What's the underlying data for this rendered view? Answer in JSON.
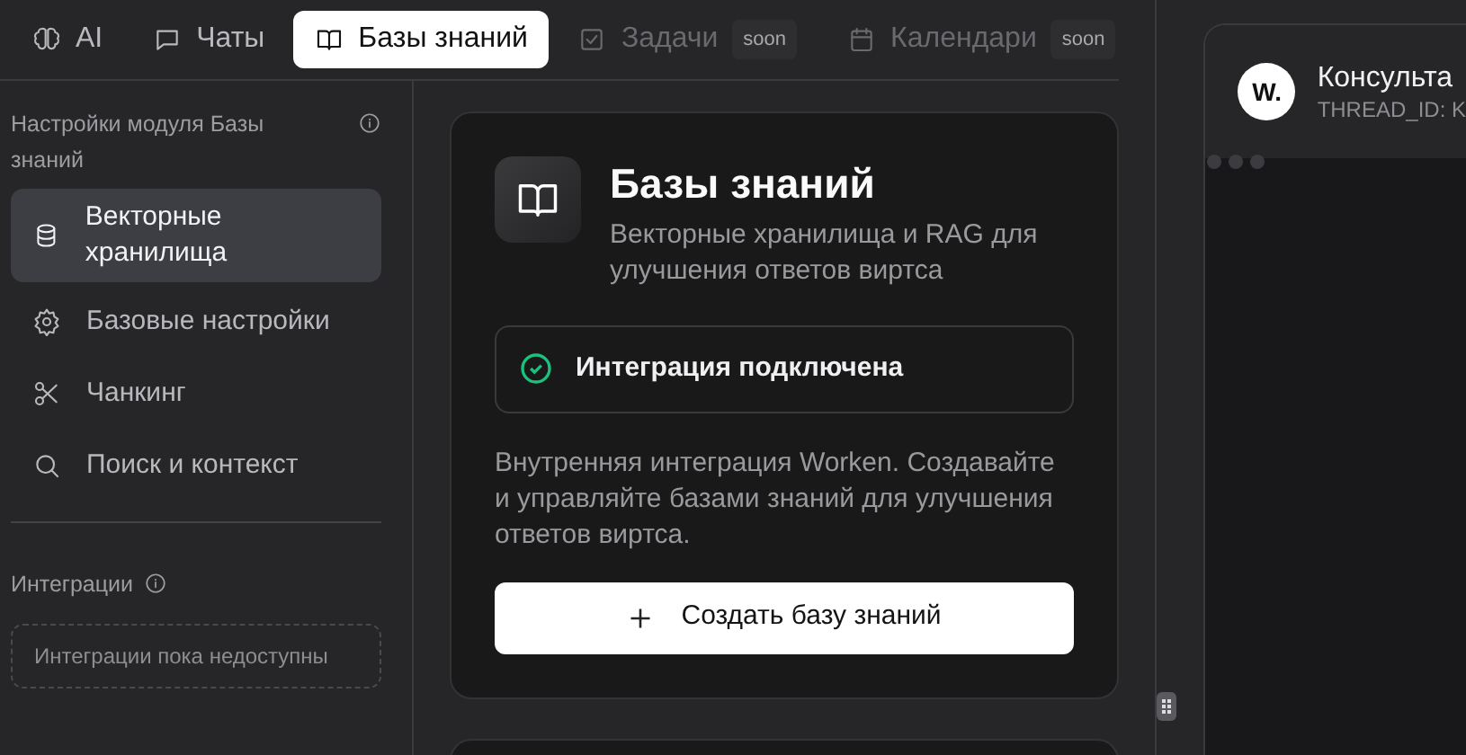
{
  "tabs": [
    {
      "label": "AI",
      "selected": false,
      "disabled": false
    },
    {
      "label": "Чаты",
      "selected": false,
      "disabled": false
    },
    {
      "label": "Базы знаний",
      "selected": true,
      "disabled": false
    },
    {
      "label": "Задачи",
      "selected": false,
      "disabled": true,
      "badge": "soon"
    },
    {
      "label": "Календари",
      "selected": false,
      "disabled": true,
      "badge": "soon"
    }
  ],
  "sidebar": {
    "title": "Настройки модуля Базы знаний",
    "items": [
      {
        "label": "Векторные хранилища",
        "selected": true
      },
      {
        "label": "Базовые настройки",
        "selected": false
      },
      {
        "label": "Чанкинг",
        "selected": false
      },
      {
        "label": "Поиск и контекст",
        "selected": false
      }
    ],
    "integrations_title": "Интеграции",
    "integrations_empty": "Интеграции пока недоступны"
  },
  "card": {
    "title": "Базы знаний",
    "subtitle": "Векторные хранилища и RAG для улучшения ответов виртса",
    "status": "Интеграция подключена",
    "connected": true,
    "description": "Внутренняя интеграция Worken. Создавайте и управляйте базами знаний для улучшения ответов виртса.",
    "button": "Создать базу знаний"
  },
  "chat": {
    "avatar": "W.",
    "title": "Консульта",
    "thread": "THREAD_ID: K",
    "typing": true
  }
}
